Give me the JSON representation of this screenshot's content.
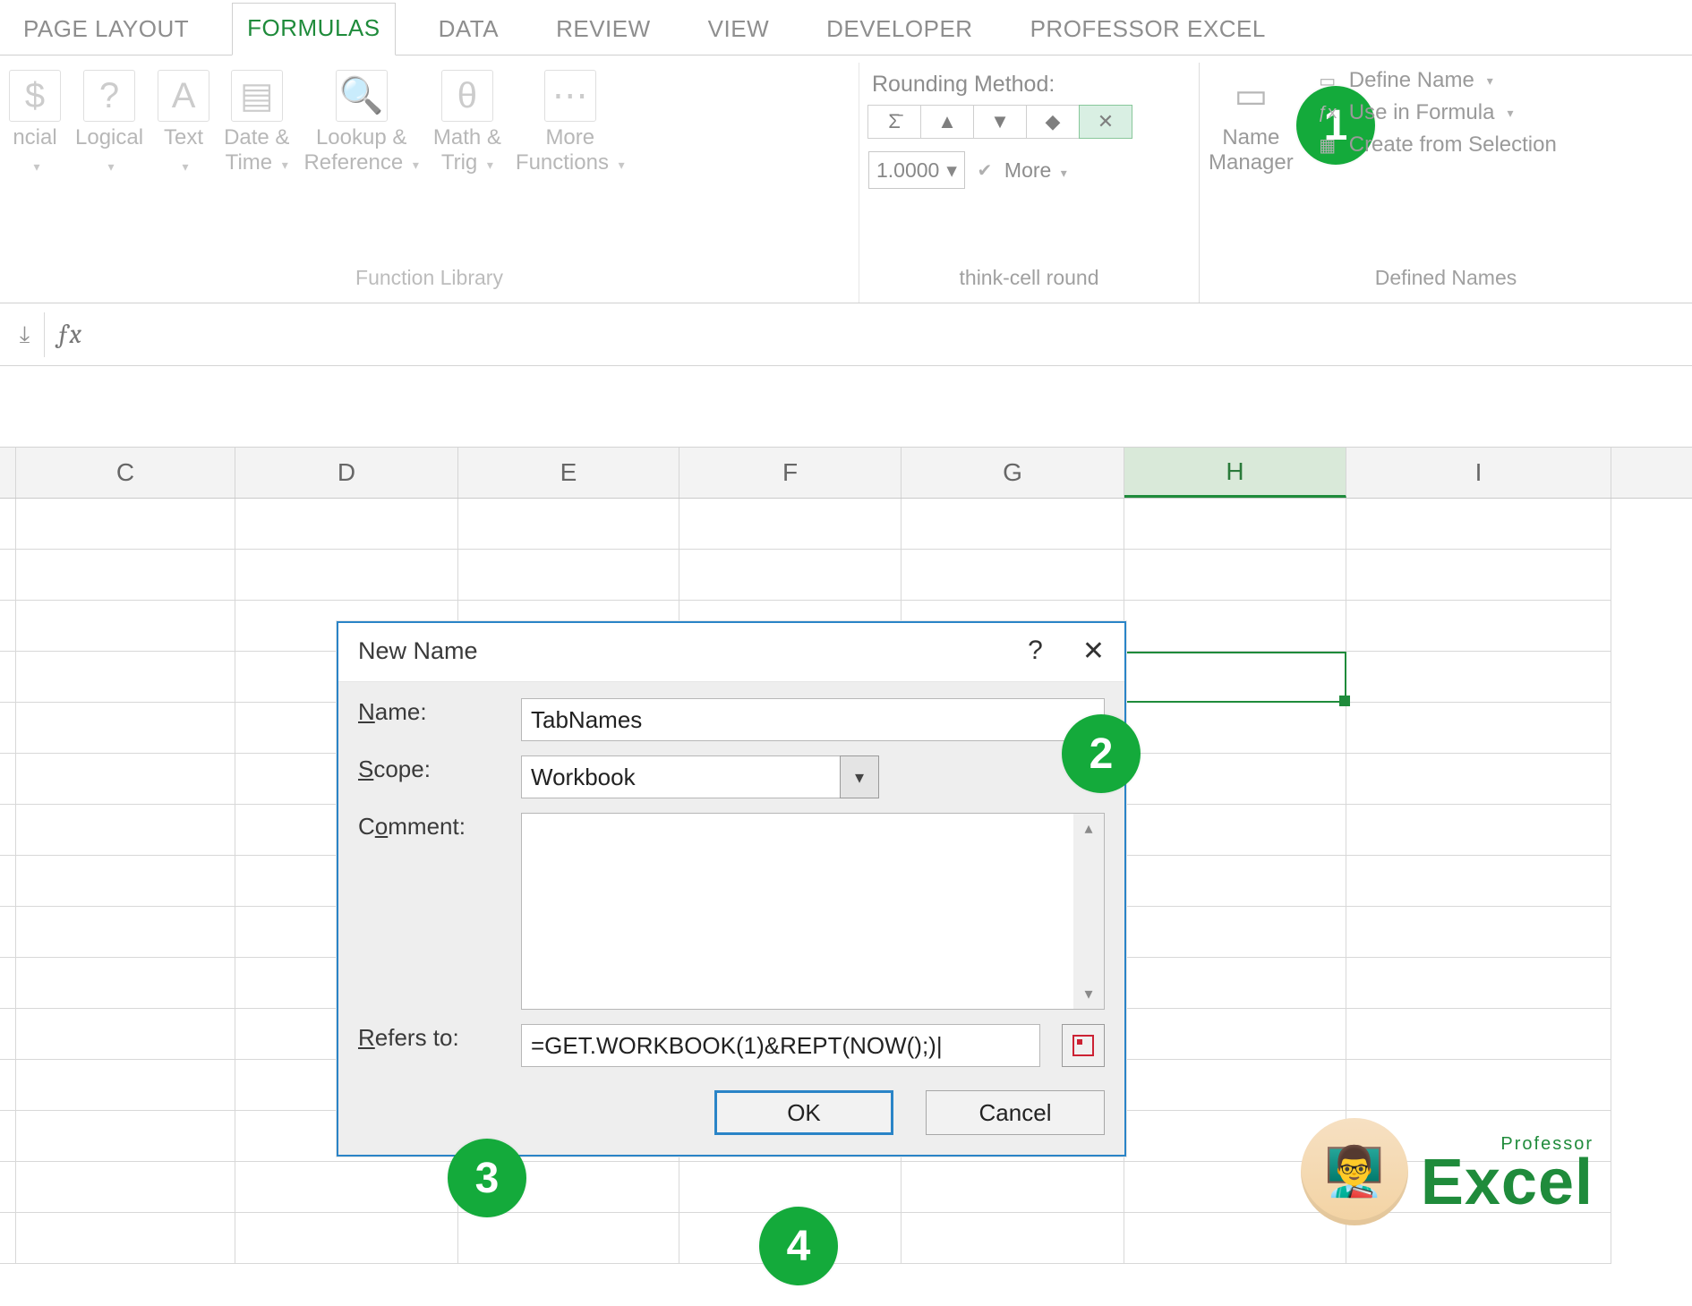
{
  "tabs": [
    "PAGE LAYOUT",
    "FORMULAS",
    "DATA",
    "REVIEW",
    "VIEW",
    "DEVELOPER",
    "PROFESSOR EXCEL"
  ],
  "active_tab_index": 1,
  "ribbon": {
    "function_library": {
      "caption": "Function Library",
      "items": [
        {
          "label": "ncial",
          "icon": "∑"
        },
        {
          "label": "Logical",
          "icon": "?"
        },
        {
          "label": "Text",
          "icon": "A"
        },
        {
          "label": "Date & Time",
          "icon": "📅",
          "split": true
        },
        {
          "label": "Lookup & Reference",
          "icon": "🔍",
          "split": true
        },
        {
          "label": "Math & Trig",
          "icon": "θ",
          "split": true
        },
        {
          "label": "More Functions",
          "icon": "⋯",
          "split": true
        }
      ]
    },
    "thinkcell": {
      "caption": "think-cell round",
      "title": "Rounding Method:",
      "value": "1.0000",
      "more": "More"
    },
    "defined_names": {
      "caption": "Defined Names",
      "name_manager": "Name Manager",
      "items": [
        "Define Name",
        "Use in Formula",
        "Create from Selection"
      ]
    }
  },
  "columns": [
    "C",
    "D",
    "E",
    "F",
    "G",
    "H",
    "I"
  ],
  "selected_column": "H",
  "dialog": {
    "title": "New Name",
    "fields": {
      "name": {
        "label": "Name:",
        "value": "TabNames"
      },
      "scope": {
        "label": "Scope:",
        "value": "Workbook"
      },
      "comment": {
        "label": "Comment:",
        "value": ""
      },
      "refers": {
        "label": "Refers to:",
        "value": "=GET.WORKBOOK(1)&REPT(NOW();)|"
      }
    },
    "ok": "OK",
    "cancel": "Cancel"
  },
  "callouts": [
    "1",
    "2",
    "3",
    "4"
  ],
  "logo": {
    "top": "Professor",
    "bottom": "Excel"
  }
}
